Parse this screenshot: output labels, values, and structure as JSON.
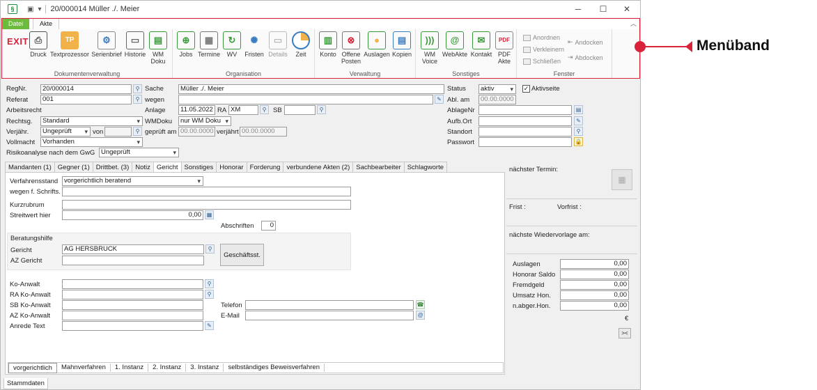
{
  "window": {
    "title": "20/000014 Müller ./. Meier",
    "app_icon": "§"
  },
  "ribbon": {
    "tabs": [
      {
        "label": "Datei"
      },
      {
        "label": "Akte"
      }
    ],
    "exit_label": "EXIT",
    "groups": [
      {
        "label": "Dokumentenverwaltung",
        "buttons": [
          "Druck",
          "Textprozessor",
          "Serienbrief",
          "Historie",
          "WM Doku"
        ]
      },
      {
        "label": "Organisation",
        "buttons": [
          "Jobs",
          "Termine",
          "WV",
          "Fristen",
          "Details",
          "Zeit"
        ]
      },
      {
        "label": "Verwaltung",
        "buttons": [
          "Konto",
          "Offene Posten",
          "Auslagen",
          "Kopien"
        ]
      },
      {
        "label": "Sonstiges",
        "buttons": [
          "WM Voice",
          "WebAkte",
          "Kontakt",
          "PDF Akte"
        ]
      },
      {
        "label": "Fenster",
        "buttons": [
          "Anordnen",
          "Verkleinern",
          "Schließen",
          "Andocken",
          "Abdocken"
        ]
      }
    ],
    "tp_icon_text": "TP",
    "pdf_icon_text": "PDF"
  },
  "callout": {
    "label": "Menüband"
  },
  "form": {
    "regnr": {
      "label": "RegNr.",
      "value": "20/000014"
    },
    "referat": {
      "label": "Referat",
      "value": "001"
    },
    "arbeitsrecht": {
      "label": "Arbeitsrecht"
    },
    "rechtsg": {
      "label": "Rechtsg.",
      "value": "Standard"
    },
    "verjaehr": {
      "label": "Verjähr.",
      "value": "Ungeprüft",
      "von_label": "von"
    },
    "vollmacht": {
      "label": "Vollmacht",
      "value": "Vorhanden"
    },
    "gwg": {
      "label": "Risikoanalyse nach dem GwG",
      "value": "Ungeprüft"
    },
    "sache": {
      "label": "Sache",
      "value": "Müller ./. Meier"
    },
    "wegen": {
      "label": "wegen",
      "value": ""
    },
    "anlage": {
      "label": "Anlage",
      "value": "11.05.2022",
      "ra_label": "RA",
      "ra_value": "XM",
      "sb_label": "SB"
    },
    "wmdoku": {
      "label": "WMDoku",
      "value": "nur WM Doku"
    },
    "geprueft": {
      "label": "geprüft am",
      "value": "00.00.0000",
      "verjaehrt_label": "verjährt",
      "verjaehrt_value": "00.00.0000"
    },
    "status": {
      "label": "Status",
      "value": "aktiv",
      "aktivseite_label": "Aktivseite",
      "aktivseite_checked": "✓"
    },
    "abl_am": {
      "label": "Abl. am",
      "value": "00.00.0000"
    },
    "ablagenr": {
      "label": "AblageNr"
    },
    "aufb_ort": {
      "label": "Aufb.Ort"
    },
    "standort": {
      "label": "Standort"
    },
    "passwort": {
      "label": "Passwort"
    }
  },
  "tabs": [
    "Mandanten (1)",
    "Gegner (1)",
    "Drittbet. (3)",
    "Notiz",
    "Gericht",
    "Sonstiges",
    "Honorar",
    "Forderung",
    "verbundene Akten (2)",
    "Sachbearbeiter",
    "Schlagworte"
  ],
  "active_tab": "Gericht",
  "gericht": {
    "verfahrensstand": {
      "label": "Verfahrensstand",
      "value": "vorgerichtlich beratend"
    },
    "wegen_schrifts": {
      "label": "wegen f. Schrifts."
    },
    "kurzrubrum": {
      "label": "Kurzrubrum"
    },
    "streitwert": {
      "label": "Streitwert hier",
      "value": "0,00"
    },
    "abschriften": {
      "label": "Abschriften",
      "value": "0"
    },
    "beratungshilfe": {
      "label": "Beratungshilfe"
    },
    "gericht": {
      "label": "Gericht",
      "value": "AG HERSBRUCK"
    },
    "az_gericht": {
      "label": "AZ Gericht"
    },
    "geschaeftsst_label": "Geschäftsst.",
    "ko_anwalt": {
      "label": "Ko-Anwalt"
    },
    "ra_ko_anwalt": {
      "label": "RA Ko-Anwalt"
    },
    "sb_ko_anwalt": {
      "label": "SB Ko-Anwalt"
    },
    "az_ko_anwalt": {
      "label": "AZ Ko-Anwalt"
    },
    "anrede_text": {
      "label": "Anrede Text"
    },
    "telefon": {
      "label": "Telefon"
    },
    "email": {
      "label": "E-Mail"
    },
    "bottom_tabs": [
      "vorgerichtlich",
      "Mahnverfahren",
      "1. Instanz",
      "2. Instanz",
      "3. Instanz",
      "selbständiges Beweisverfahren"
    ]
  },
  "side": {
    "naechster_termin": "nächster Termin:",
    "frist": "Frist :",
    "vorfrist": "Vorfrist :",
    "wiedervorlage": "nächste Wiedervorlage am:",
    "money": [
      {
        "label": "Auslagen",
        "value": "0,00"
      },
      {
        "label": "Honorar Saldo",
        "value": "0,00"
      },
      {
        "label": "Fremdgeld",
        "value": "0,00"
      },
      {
        "label": "Umsatz Hon.",
        "value": "0,00"
      },
      {
        "label": "n.abger.Hon.",
        "value": "0,00"
      }
    ],
    "currency": "€",
    "collapse_label": "><"
  },
  "footer": {
    "stammdaten": "Stammdaten"
  }
}
